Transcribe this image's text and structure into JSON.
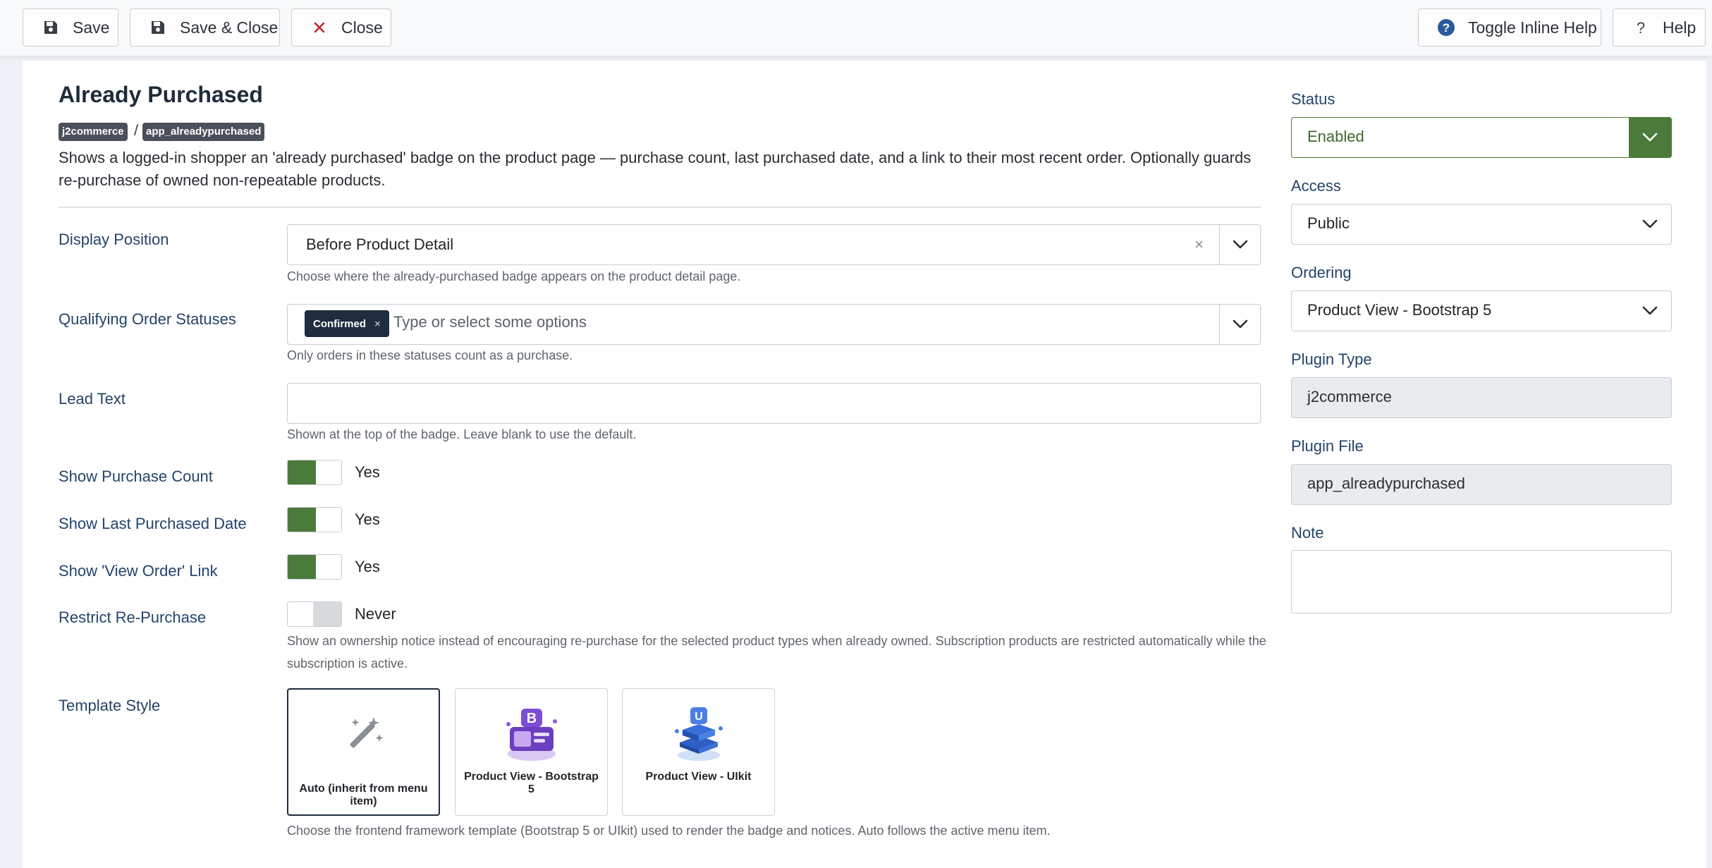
{
  "toolbar": {
    "save": "Save",
    "save_close": "Save & Close",
    "close": "Close",
    "toggle_inline_help": "Toggle Inline Help",
    "help": "Help"
  },
  "header": {
    "title": "Already Purchased",
    "badges": [
      "j2commerce",
      "app_alreadypurchased"
    ],
    "separator": "/",
    "description": "Shows a logged-in shopper an 'already purchased' badge on the product page — purchase count, last purchased date, and a link to their most recent order. Optionally guards re-purchase of owned non-repeatable products."
  },
  "fields": {
    "display_position": {
      "label": "Display Position",
      "value": "Before Product Detail",
      "clear": "×",
      "help": "Choose where the already-purchased badge appears on the product detail page."
    },
    "qualifying_statuses": {
      "label": "Qualifying Order Statuses",
      "chips": [
        "Confirmed"
      ],
      "chip_remove": "×",
      "placeholder": "Type or select some options",
      "help": "Only orders in these statuses count as a purchase."
    },
    "lead_text": {
      "label": "Lead Text",
      "value": "",
      "help": "Shown at the top of the badge. Leave blank to use the default."
    },
    "show_purchase_count": {
      "label": "Show Purchase Count",
      "state": "Yes",
      "on": true
    },
    "show_last_purchased": {
      "label": "Show Last Purchased Date",
      "state": "Yes",
      "on": true
    },
    "show_view_order": {
      "label": "Show 'View Order' Link",
      "state": "Yes",
      "on": true
    },
    "restrict_repurchase": {
      "label": "Restrict Re-Purchase",
      "state": "Never",
      "on": false,
      "help": "Show an ownership notice instead of encouraging re-purchase for the selected product types when already owned. Subscription products are restricted automatically while the subscription is active."
    },
    "template_style": {
      "label": "Template Style",
      "options": [
        {
          "label": "Auto (inherit from menu item)",
          "icon": "magic-wand-icon",
          "selected": true
        },
        {
          "label": "Product View - Bootstrap 5",
          "icon": "bootstrap-icon",
          "selected": false
        },
        {
          "label": "Product View - UIkit",
          "icon": "uikit-icon",
          "selected": false
        }
      ],
      "help": "Choose the frontend framework template (Bootstrap 5 or UIkit) used to render the badge and notices. Auto follows the active menu item."
    }
  },
  "sidebar": {
    "status": {
      "label": "Status",
      "value": "Enabled"
    },
    "access": {
      "label": "Access",
      "value": "Public"
    },
    "ordering": {
      "label": "Ordering",
      "value": "Product View - Bootstrap 5"
    },
    "plugin_type": {
      "label": "Plugin Type",
      "value": "j2commerce"
    },
    "plugin_file": {
      "label": "Plugin File",
      "value": "app_alreadypurchased"
    },
    "note": {
      "label": "Note",
      "value": ""
    }
  },
  "colors": {
    "accent_green": "#4b7a3a",
    "navy": "#1f2d3f",
    "label_blue": "#24446a",
    "close_red": "#c52827",
    "help_blue": "#2a5b9c"
  }
}
